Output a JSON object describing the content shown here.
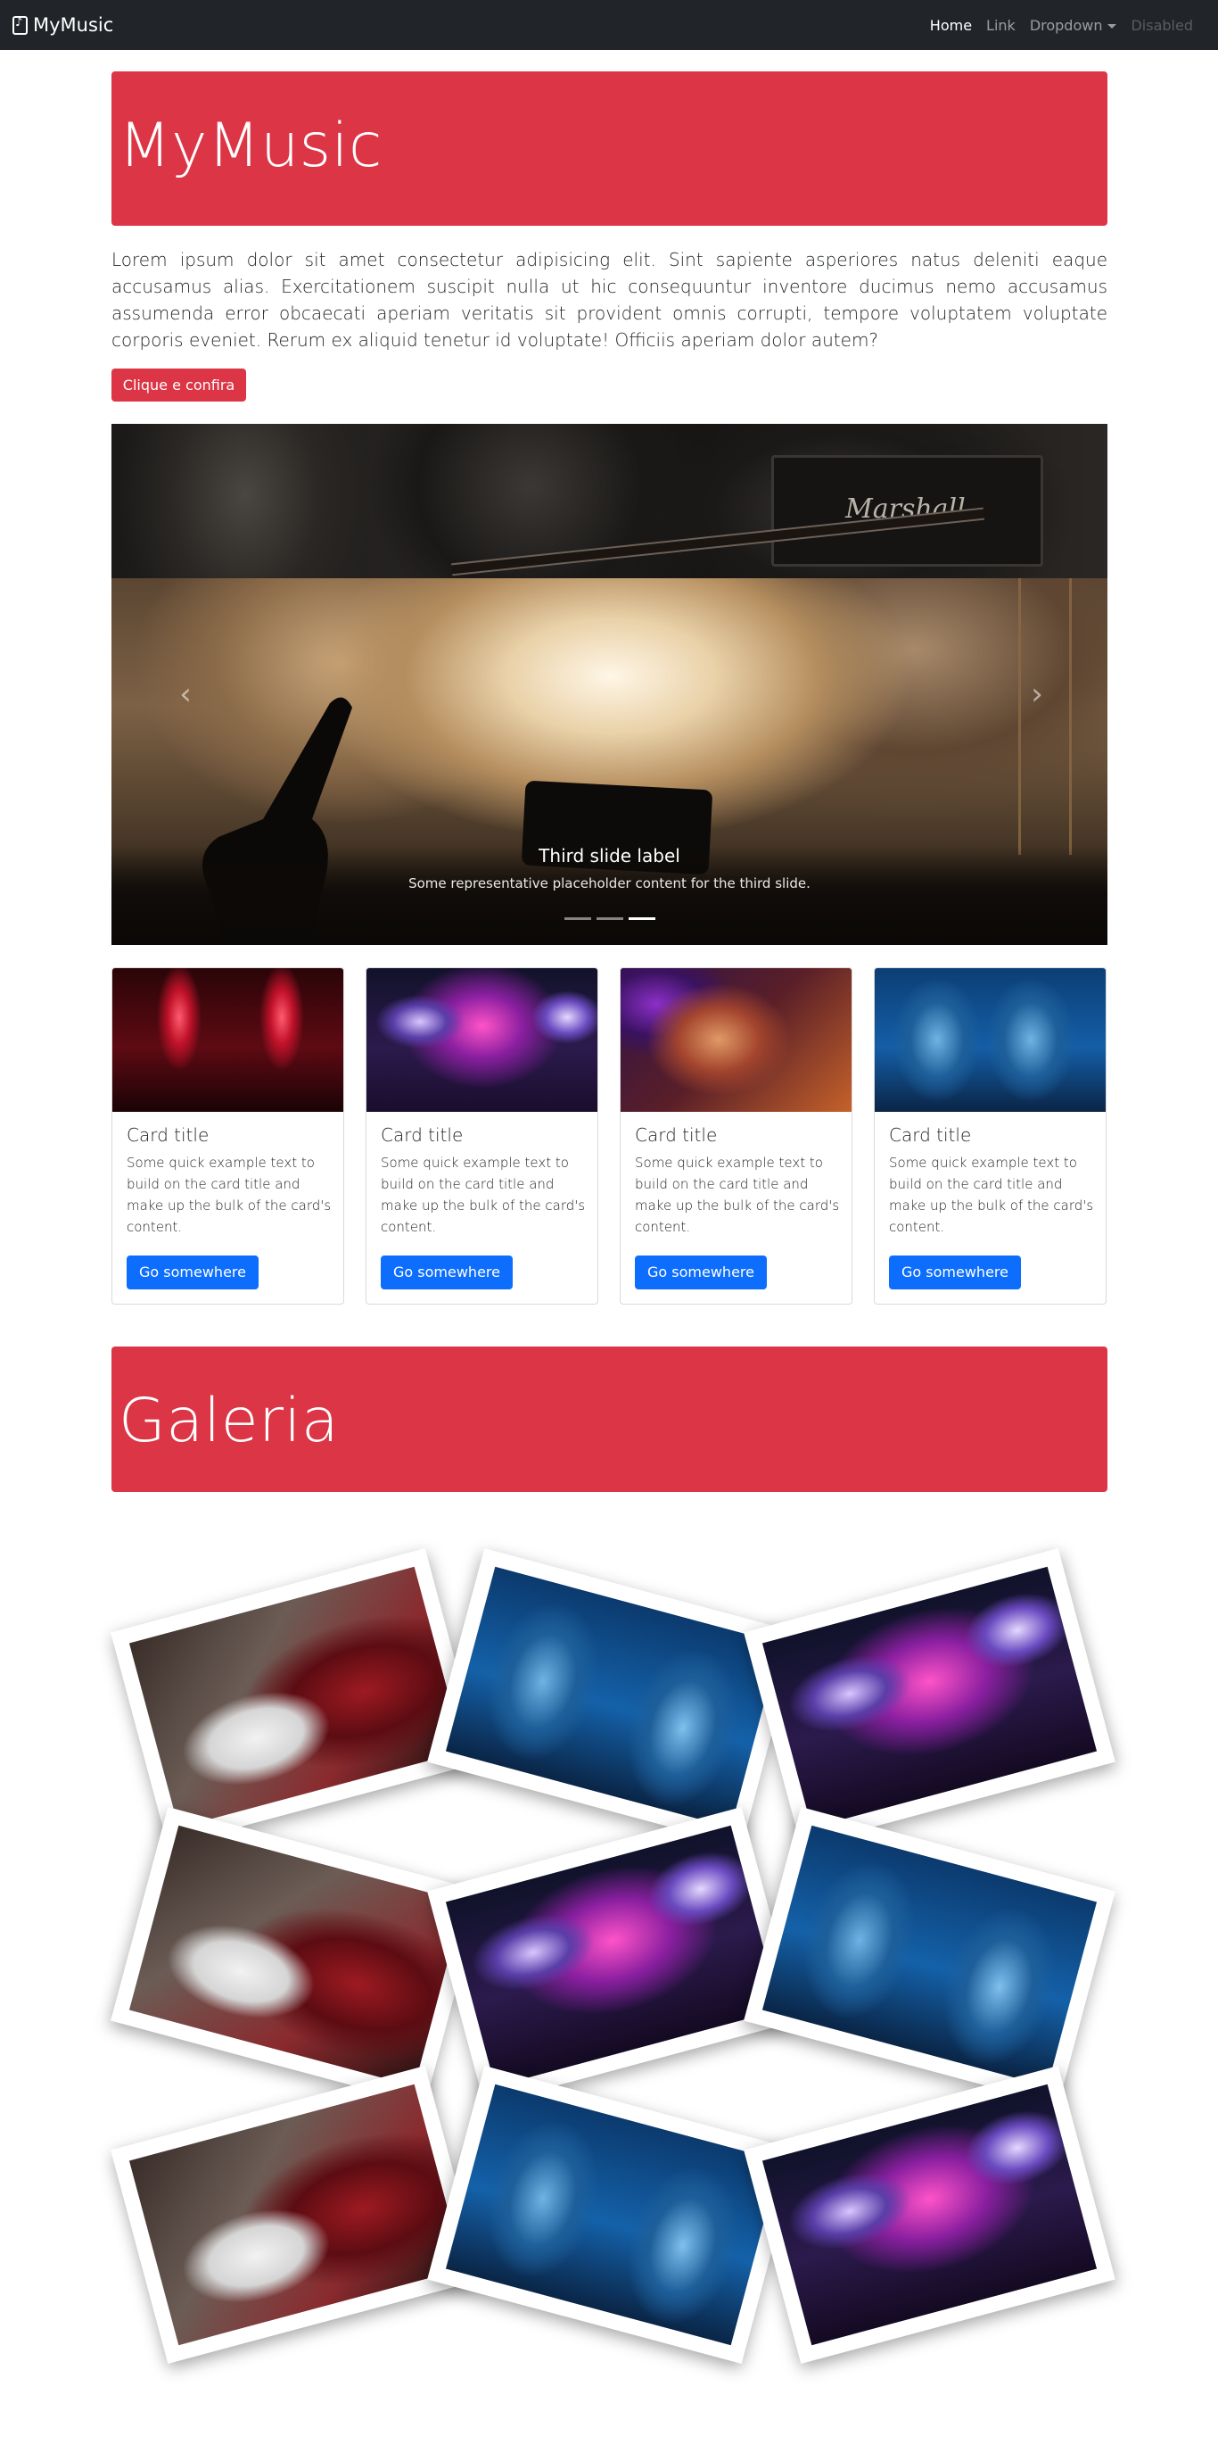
{
  "navbar": {
    "brand": "MyMusic",
    "brand_icon": "music-note-icon",
    "links": [
      {
        "label": "Home",
        "state": "active"
      },
      {
        "label": "Link",
        "state": "normal"
      },
      {
        "label": "Dropdown",
        "state": "dropdown"
      },
      {
        "label": "Disabled",
        "state": "disabled"
      }
    ]
  },
  "hero": {
    "title": "MyMusic",
    "lead": "Lorem ipsum dolor sit amet consectetur adipisicing elit. Sint sapiente asperiores natus deleniti eaque accusamus alias. Exercitationem suscipit nulla ut hic consequuntur inventore ducimus nemo accusamus assumenda error obcaecati aperiam veritatis sit provident omnis corrupti, tempore voluptatem voluptate corporis eveniet. Rerum ex aliquid tenetur id voluptate! Officiis aperiam dolor autem?",
    "button": "Clique e confira"
  },
  "carousel": {
    "prev_icon": "chevron-left-icon",
    "next_icon": "chevron-right-icon",
    "caption_title": "Third slide label",
    "caption_text": "Some representative placeholder content for the third slide.",
    "amp_brand": "Marshall",
    "indicators": 3,
    "active_indicator": 3
  },
  "cards": [
    {
      "title": "Card title",
      "text": "Some quick example text to build on the card title and make up the bulk of the card's content.",
      "button": "Go somewhere"
    },
    {
      "title": "Card title",
      "text": "Some quick example text to build on the card title and make up the bulk of the card's content.",
      "button": "Go somewhere"
    },
    {
      "title": "Card title",
      "text": "Some quick example text to build on the card title and make up the bulk of the card's content.",
      "button": "Go somewhere"
    },
    {
      "title": "Card title",
      "text": "Some quick example text to build on the card title and make up the bulk of the card's content.",
      "button": "Go somewhere"
    }
  ],
  "gallery": {
    "title": "Galeria"
  },
  "colors": {
    "navbar": "#212529",
    "brand_red": "#dc3545",
    "primary_blue": "#0d6efd"
  }
}
